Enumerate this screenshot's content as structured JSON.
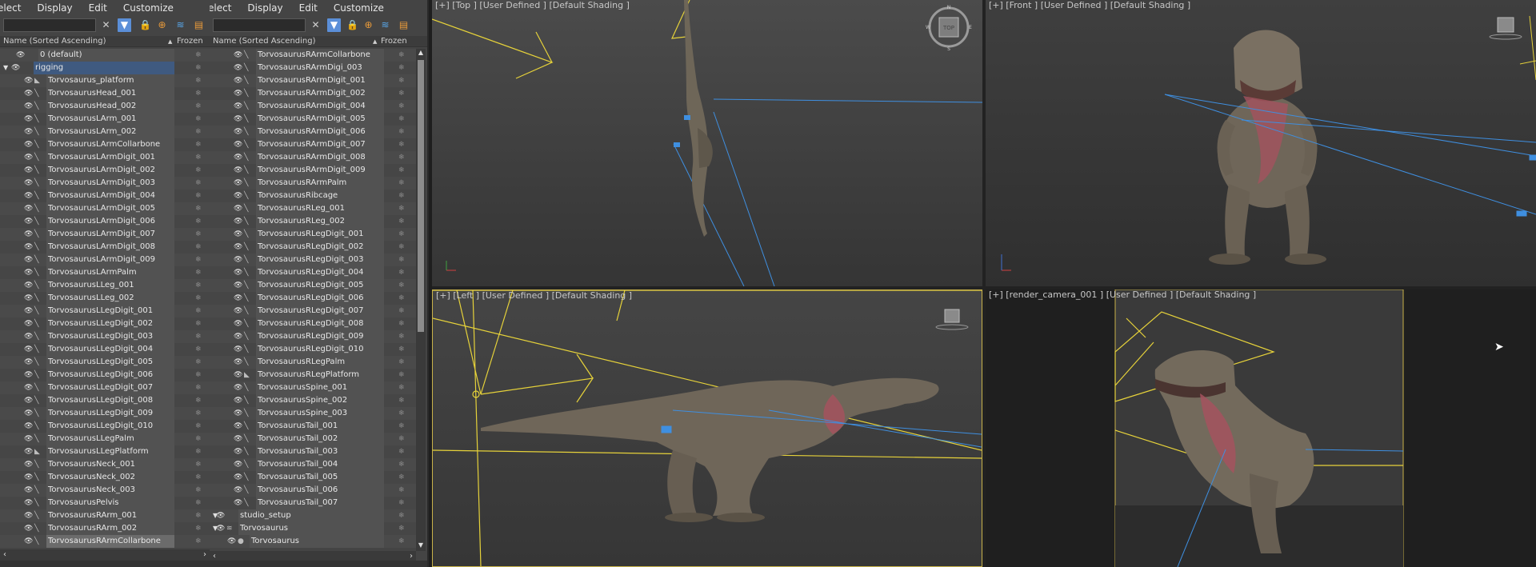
{
  "explorer_left": {
    "menu": [
      "elect",
      "Display",
      "Edit",
      "Customize"
    ],
    "columns": {
      "name": "Name (Sorted Ascending)",
      "frozen": "Frozen"
    },
    "rows": [
      "0 (default)",
      "rigging",
      "Torvosaurus_platform",
      "TorvosaurusHead_001",
      "TorvosaurusHead_002",
      "TorvosaurusLArm_001",
      "TorvosaurusLArm_002",
      "TorvosaurusLArmCollarbone",
      "TorvosaurusLArmDigit_001",
      "TorvosaurusLArmDigit_002",
      "TorvosaurusLArmDigit_003",
      "TorvosaurusLArmDigit_004",
      "TorvosaurusLArmDigit_005",
      "TorvosaurusLArmDigit_006",
      "TorvosaurusLArmDigit_007",
      "TorvosaurusLArmDigit_008",
      "TorvosaurusLArmDigit_009",
      "TorvosaurusLArmPalm",
      "TorvosaurusLLeg_001",
      "TorvosaurusLLeg_002",
      "TorvosaurusLLegDigit_001",
      "TorvosaurusLLegDigit_002",
      "TorvosaurusLLegDigit_003",
      "TorvosaurusLLegDigit_004",
      "TorvosaurusLLegDigit_005",
      "TorvosaurusLLegDigit_006",
      "TorvosaurusLLegDigit_007",
      "TorvosaurusLLegDigit_008",
      "TorvosaurusLLegDigit_009",
      "TorvosaurusLLegDigit_010",
      "TorvosaurusLLegPalm",
      "TorvosaurusLLegPlatform",
      "TorvosaurusNeck_001",
      "TorvosaurusNeck_002",
      "TorvosaurusNeck_003",
      "TorvosaurusPelvis",
      "TorvosaurusRArm_001",
      "TorvosaurusRArm_002",
      "TorvosaurusRArmCollarbone"
    ]
  },
  "explorer_right": {
    "menu": [
      "elect",
      "Display",
      "Edit",
      "Customize"
    ],
    "columns": {
      "name": "Name (Sorted Ascending)",
      "frozen": "Frozen"
    },
    "rows": [
      "TorvosaurusRArmCollarbone",
      "TorvosaurusRArmDigi_003",
      "TorvosaurusRArmDigit_001",
      "TorvosaurusRArmDigit_002",
      "TorvosaurusRArmDigit_004",
      "TorvosaurusRArmDigit_005",
      "TorvosaurusRArmDigit_006",
      "TorvosaurusRArmDigit_007",
      "TorvosaurusRArmDigit_008",
      "TorvosaurusRArmDigit_009",
      "TorvosaurusRArmPalm",
      "TorvosaurusRibcage",
      "TorvosaurusRLeg_001",
      "TorvosaurusRLeg_002",
      "TorvosaurusRLegDigit_001",
      "TorvosaurusRLegDigit_002",
      "TorvosaurusRLegDigit_003",
      "TorvosaurusRLegDigit_004",
      "TorvosaurusRLegDigit_005",
      "TorvosaurusRLegDigit_006",
      "TorvosaurusRLegDigit_007",
      "TorvosaurusRLegDigit_008",
      "TorvosaurusRLegDigit_009",
      "TorvosaurusRLegDigit_010",
      "TorvosaurusRLegPalm",
      "TorvosaurusRLegPlatform",
      "TorvosaurusSpine_001",
      "TorvosaurusSpine_002",
      "TorvosaurusSpine_003",
      "TorvosaurusTail_001",
      "TorvosaurusTail_002",
      "TorvosaurusTail_003",
      "TorvosaurusTail_004",
      "TorvosaurusTail_005",
      "TorvosaurusTail_006",
      "TorvosaurusTail_007",
      "studio_setup",
      "Torvosaurus",
      "Torvosaurus"
    ]
  },
  "viewports": {
    "top": "[+] [Top ] [User Defined ] [Default Shading ]",
    "front": "[+] [Front ] [User Defined ] [Default Shading ]",
    "left": "[+] [Left ] [User Defined ] [Default Shading ]",
    "camera": "[+] [render_camera_001 ] [User Defined ] [Default Shading ]"
  },
  "viewcube": {
    "top": "TOP",
    "compass": [
      "N",
      "E",
      "S",
      "W"
    ]
  },
  "colors": {
    "panel_bg": "#444444",
    "selection_blue": "#5878a8",
    "active_viewport_border": "#c8b24a",
    "helper_yellow": "#e6d23a",
    "bone_blue": "#3f8fe0",
    "skin": "#8a7e6e",
    "throat_red": "#a4525e"
  }
}
